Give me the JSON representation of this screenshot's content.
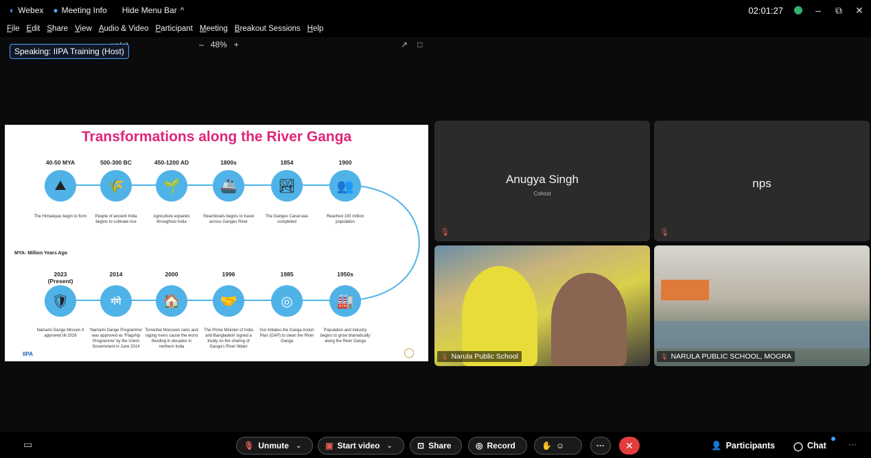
{
  "titlebar": {
    "app_name": "Webex",
    "meeting_info": "Meeting Info",
    "hide_menu": "Hide Menu Bar",
    "hide_menu_chevron": "^",
    "clock": "02:01:27",
    "minimize": "–",
    "restore": "⧉",
    "close": "✕"
  },
  "menubar": {
    "items": [
      "File",
      "Edit",
      "Share",
      "View",
      "Audio & Video",
      "Participant",
      "Meeting",
      "Breakout Sessions",
      "Help"
    ]
  },
  "share": {
    "speaking_label": "Speaking: IIPA Training (Host)",
    "behind_title": "on(s)",
    "zoom_minus": "–",
    "zoom_level": "48%",
    "zoom_plus": "+",
    "tool_a": "↗",
    "tool_b": "□"
  },
  "slide": {
    "title": "Transformations along the River Ganga",
    "mya_note": "MYA- Million Years Ago",
    "footer_logo": "IIPA",
    "top_row": [
      {
        "period": "40-50 MYA",
        "icon": "⛰",
        "desc": "The Himalayas begin to form"
      },
      {
        "period": "500-300 BC",
        "icon": "🌾",
        "desc": "People of ancient India begins to cultivate rice"
      },
      {
        "period": "450-1200 AD",
        "icon": "🌱",
        "desc": "Agriculture expands throughout India"
      },
      {
        "period": "1800s",
        "icon": "🚢",
        "desc": "Steamboats begins to travel across Ganges River"
      },
      {
        "period": "1854",
        "icon": "🏞",
        "desc": "The Ganges Canal was completed"
      },
      {
        "period": "1900",
        "icon": "👥",
        "desc": "Reached 100 million population"
      }
    ],
    "bottom_row": [
      {
        "period": "2023\n(Present)",
        "icon": "🛡",
        "desc": "Namami Gange Mission II approved till 2026"
      },
      {
        "period": "2014",
        "icon": "गंगे",
        "desc": "'Namami Gange Programme' was approved as 'Flagship Programme' by the Union Government in June 2014"
      },
      {
        "period": "2000",
        "icon": "🏠",
        "desc": "Torrential Monsoon rains and raging rivers cause the worst flooding in decades in northern India"
      },
      {
        "period": "1996",
        "icon": "🤝",
        "desc": "The Prime Minister of India and Bangladesh signed a treaty on the sharing of Ganga's River Water"
      },
      {
        "period": "1985",
        "icon": "◎",
        "desc": "GoI initiates the Ganga Action Plan (GAP) to clean the River Ganga"
      },
      {
        "period": "1950s",
        "icon": "🏭",
        "desc": "Population and industry begins to grow dramatically along the River Ganga"
      }
    ]
  },
  "tiles": {
    "anugya": {
      "name": "Anugya Singh",
      "role": "Cohost"
    },
    "nps": {
      "name": "nps"
    },
    "narula1": {
      "name": "Narula Public School"
    },
    "narula2": {
      "name": "NARULA PUBLIC SCHOOL, MOGRA"
    }
  },
  "controls": {
    "unmute": "Unmute",
    "start_video": "Start video",
    "share": "Share",
    "record": "Record",
    "more": "···",
    "leave": "✕",
    "participants": "Participants",
    "chat": "Chat",
    "overflow": "···"
  },
  "colors": {
    "accent": "#4aa3ff",
    "leave_red": "#e33c3c",
    "slide_title": "#e0257a",
    "timeline_blue": "#4fb3e8"
  }
}
